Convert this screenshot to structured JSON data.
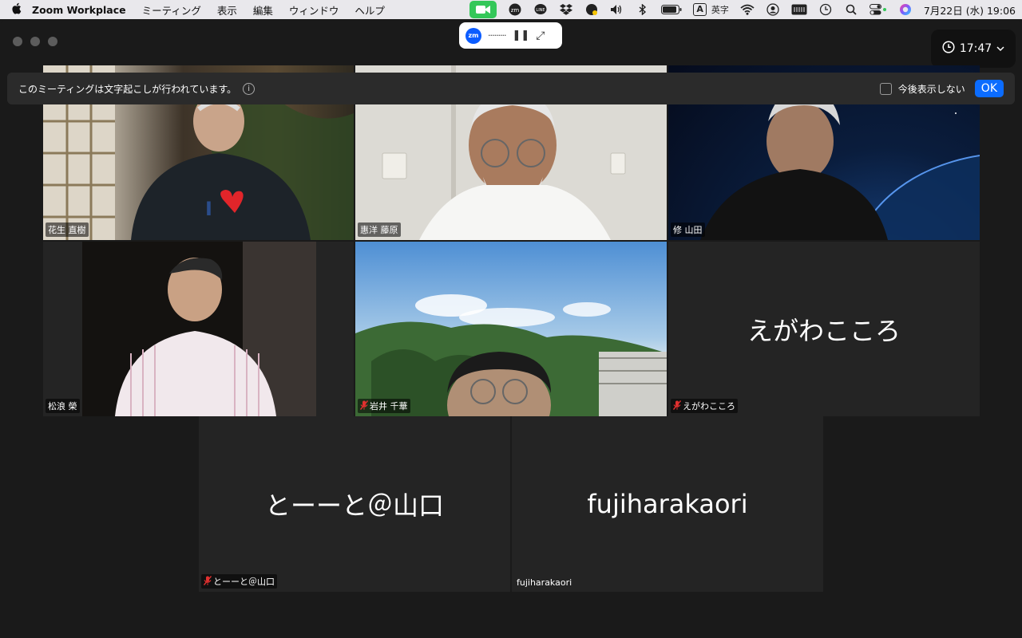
{
  "menubar": {
    "app_name": "Zoom Workplace",
    "items": [
      "ミーティング",
      "表示",
      "編集",
      "ウィンドウ",
      "ヘルプ"
    ],
    "ime": "A",
    "ime_label": "英字",
    "clock": "7月22日 (水)  19:06"
  },
  "toolbar": {
    "zm_label": "zm",
    "dots": "·········",
    "pause_glyph": "❚❚",
    "expand_glyph": "⤢"
  },
  "timer": {
    "time": "17:47",
    "clock_glyph": "◷",
    "chevron": "⌄"
  },
  "banner": {
    "message": "このミーティングは文字起こしが行われています。",
    "info_glyph": "i",
    "checkbox_label": "今後表示しない",
    "ok_label": "OK"
  },
  "participants": [
    {
      "name": "花生 直樹",
      "muted": false,
      "video": true
    },
    {
      "name": "惠洋 藤原",
      "muted": false,
      "video": true,
      "active": true
    },
    {
      "name": "修 山田",
      "muted": false,
      "video": true
    },
    {
      "name": "松浪 榮",
      "muted": false,
      "video": true
    },
    {
      "name": "岩井 千華",
      "muted": true,
      "video": true
    },
    {
      "name": "えがわこころ",
      "muted": true,
      "video": false,
      "display_name": "えがわこころ"
    },
    {
      "name": "とーーと＠山口",
      "muted": true,
      "video": false,
      "display_name": "とーーと＠山口"
    },
    {
      "name": "fujiharakaori",
      "muted": false,
      "video": false,
      "display_name": "fujiharakaori"
    }
  ],
  "colors": {
    "active_speaker": "#2fbd5b",
    "ok_button": "#0b6cff",
    "mute_icon": "#e0302f"
  }
}
